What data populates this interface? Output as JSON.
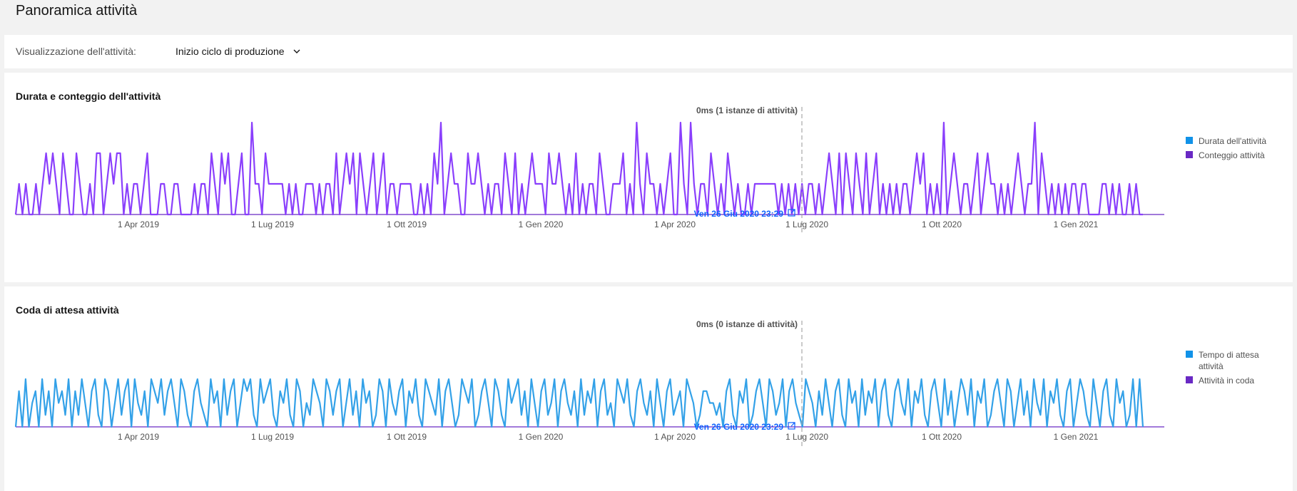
{
  "page": {
    "title": "Panoramica attività"
  },
  "toolbar": {
    "view_label": "Visualizzazione dell'attività:",
    "view_value": "Inizio ciclo di produzione"
  },
  "colors": {
    "duration": "#1192e8",
    "count": "#6929c4",
    "wait": "#1192e8",
    "queued": "#6929c4",
    "count_line": "#8a3ffc",
    "wait_line": "#33a1e8",
    "link": "#0f62fe"
  },
  "charts": [
    {
      "title": "Durata e conteggio dell'attività",
      "marker_label": "0ms (1 istanze di attività)",
      "marker_date": "Ven 26 Giu 2020 23:29",
      "legend": [
        "Durata dell'attività",
        "Conteggio attività"
      ]
    },
    {
      "title": "Coda di attesa attività",
      "marker_label": "0ms (0 istanze di attività)",
      "marker_date": "Ven 26 Giu 2020 23:29",
      "legend": [
        "Tempo di attesa attività",
        "Attività in coda"
      ]
    }
  ],
  "chart_data": [
    {
      "type": "line",
      "x_ticks": [
        "1 Apr 2019",
        "1 Lug 2019",
        "1 Ott 2019",
        "1 Gen 2020",
        "1 Apr 2020",
        "1 Lug 2020",
        "1 Ott 2020",
        "1 Gen 2021"
      ],
      "series": [
        {
          "name": "Durata dell'attività",
          "values": []
        },
        {
          "name": "Conteggio attività",
          "values": [
            0,
            1,
            0,
            1,
            0,
            0,
            1,
            0,
            1,
            2,
            1,
            2,
            1,
            0,
            2,
            1,
            0,
            0,
            2,
            1,
            0,
            0,
            1,
            0,
            2,
            2,
            0,
            1,
            2,
            1,
            2,
            2,
            0,
            1,
            0,
            1,
            1,
            0,
            1,
            2,
            0,
            0,
            0,
            1,
            1,
            0,
            0,
            1,
            1,
            0,
            0,
            0,
            0,
            1,
            0,
            1,
            1,
            0,
            2,
            1,
            0,
            2,
            1,
            2,
            0,
            0,
            1,
            2,
            0,
            0,
            3,
            1,
            1,
            0,
            2,
            1,
            1,
            1,
            1,
            1,
            0,
            1,
            0,
            1,
            0,
            0,
            1,
            1,
            1,
            0,
            1,
            0,
            1,
            1,
            0,
            2,
            0,
            1,
            2,
            1,
            2,
            0,
            2,
            1,
            0,
            1,
            2,
            0,
            1,
            2,
            0,
            1,
            1,
            0,
            1,
            1,
            1,
            1,
            0,
            0,
            1,
            0,
            1,
            0,
            2,
            1,
            3,
            0,
            1,
            2,
            1,
            1,
            0,
            0,
            2,
            1,
            1,
            2,
            1,
            0,
            1,
            0,
            1,
            1,
            0,
            2,
            1,
            0,
            2,
            0,
            1,
            0,
            1,
            2,
            1,
            1,
            1,
            0,
            2,
            1,
            1,
            2,
            1,
            0,
            1,
            0,
            2,
            0,
            1,
            0,
            1,
            1,
            0,
            2,
            1,
            0,
            0,
            1,
            1,
            1,
            2,
            0,
            1,
            0,
            3,
            1,
            0,
            2,
            1,
            1,
            0,
            1,
            0,
            1,
            2,
            0,
            0,
            3,
            1,
            0,
            3,
            1,
            0,
            1,
            1,
            0,
            2,
            1,
            0,
            1,
            0,
            2,
            1,
            0,
            1,
            0,
            0,
            1,
            0,
            1,
            1,
            1,
            1,
            1,
            1,
            1,
            0,
            1,
            0,
            1,
            0,
            1,
            0,
            1,
            0,
            1,
            1,
            0,
            1,
            0,
            1,
            2,
            1,
            0,
            2,
            0,
            2,
            1,
            0,
            2,
            1,
            0,
            2,
            0,
            1,
            2,
            0,
            1,
            0,
            1,
            0,
            1,
            0,
            1,
            1,
            0,
            1,
            2,
            1,
            2,
            0,
            1,
            0,
            1,
            0,
            3,
            0,
            1,
            2,
            1,
            0,
            1,
            1,
            0,
            1,
            2,
            0,
            1,
            2,
            1,
            1,
            0,
            1,
            0,
            1,
            0,
            1,
            2,
            1,
            0,
            1,
            1,
            3,
            0,
            2,
            1,
            0,
            1,
            0,
            1,
            0,
            1,
            0,
            1,
            1,
            0,
            1,
            1,
            0,
            0,
            0,
            0,
            1,
            1,
            0,
            1,
            0,
            1,
            0,
            0,
            1,
            0,
            1,
            0,
            0
          ]
        }
      ],
      "marker_date": "Ven 26 Giu 2020 23:29"
    },
    {
      "type": "line",
      "x_ticks": [
        "1 Apr 2019",
        "1 Lug 2019",
        "1 Ott 2019",
        "1 Gen 2020",
        "1 Apr 2020",
        "1 Lug 2020",
        "1 Ott 2020",
        "1 Gen 2021"
      ],
      "series": [
        {
          "name": "Tempo di attesa attività",
          "values": [
            0,
            3,
            0,
            4,
            0,
            2,
            3,
            0,
            4,
            1,
            3,
            0,
            4,
            2,
            3,
            1,
            4,
            0,
            3,
            1,
            4,
            2,
            0,
            3,
            4,
            1,
            0,
            4,
            3,
            0,
            2,
            4,
            1,
            3,
            4,
            0,
            4,
            2,
            1,
            3,
            0,
            4,
            3,
            2,
            4,
            1,
            3,
            4,
            2,
            0,
            4,
            3,
            1,
            0,
            3,
            4,
            2,
            1,
            0,
            4,
            2,
            3,
            0,
            4,
            1,
            3,
            4,
            0,
            2,
            4,
            3,
            4,
            1,
            0,
            4,
            2,
            3,
            4,
            1,
            0,
            3,
            2,
            4,
            1,
            0,
            4,
            3,
            0,
            2,
            1,
            4,
            3,
            2,
            0,
            4,
            3,
            1,
            3,
            4,
            0,
            2,
            4,
            1,
            3,
            0,
            4,
            2,
            3,
            0,
            1,
            4,
            3,
            0,
            4,
            2,
            1,
            3,
            4,
            0,
            3,
            2,
            4,
            1,
            0,
            4,
            3,
            2,
            1,
            4,
            0,
            3,
            4,
            2,
            0,
            1,
            4,
            3,
            2,
            4,
            0,
            1,
            3,
            4,
            2,
            0,
            4,
            3,
            1,
            0,
            4,
            2,
            3,
            4,
            1,
            3,
            0,
            4,
            2,
            0,
            3,
            4,
            1,
            2,
            4,
            0,
            3,
            4,
            2,
            1,
            3,
            0,
            4,
            1,
            3,
            2,
            4,
            0,
            3,
            4,
            1,
            2,
            0,
            4,
            3,
            2,
            4,
            1,
            0,
            3,
            4,
            2,
            1,
            3,
            0,
            4,
            2,
            0,
            3,
            4,
            1,
            2,
            3,
            0,
            4,
            3,
            2,
            0,
            1,
            3,
            3,
            2,
            2,
            1,
            2,
            0,
            3,
            4,
            1,
            0,
            3,
            2,
            4,
            0,
            1,
            3,
            4,
            2,
            0,
            4,
            3,
            1,
            2,
            4,
            0,
            3,
            4,
            2,
            1,
            0,
            4,
            3,
            2,
            0,
            3,
            1,
            4,
            2,
            0,
            3,
            4,
            1,
            0,
            4,
            2,
            3,
            0,
            4,
            1,
            3,
            2,
            4,
            0,
            3,
            4,
            1,
            0,
            3,
            4,
            2,
            1,
            4,
            0,
            3,
            2,
            4,
            1,
            0,
            3,
            4,
            2,
            0,
            4,
            1,
            3,
            0,
            2,
            4,
            3,
            1,
            4,
            0,
            3,
            2,
            4,
            0,
            1,
            3,
            4,
            2,
            0,
            4,
            3,
            0,
            2,
            4,
            1,
            3,
            0,
            4,
            2,
            1,
            4,
            0,
            3,
            2,
            4,
            1,
            0,
            3,
            4,
            0,
            2,
            4,
            3,
            1,
            0,
            4,
            2,
            0,
            3,
            4,
            1,
            0,
            4,
            2,
            3,
            0,
            1,
            4,
            0,
            4,
            0
          ]
        },
        {
          "name": "Attività in coda",
          "values": []
        }
      ],
      "marker_date": "Ven 26 Giu 2020 23:29"
    }
  ]
}
